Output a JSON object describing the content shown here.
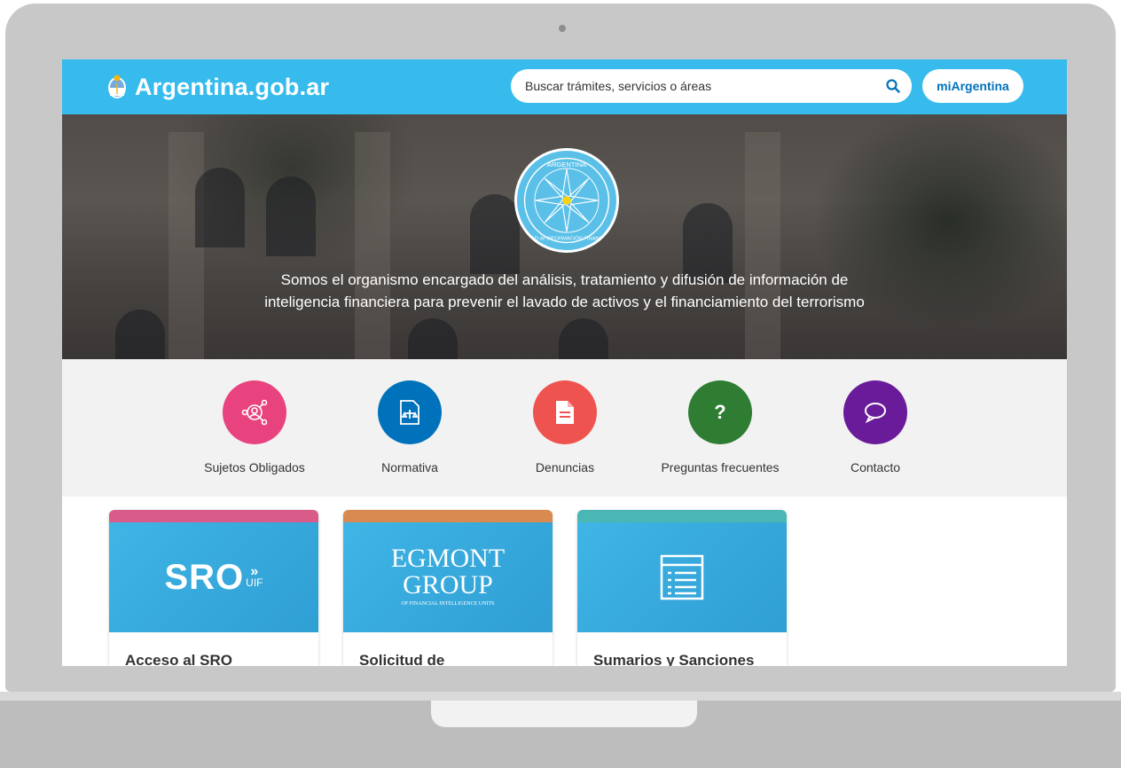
{
  "header": {
    "site_name": "Argentina.gob.ar",
    "search_placeholder": "Buscar trámites, servicios o áreas",
    "account_button": "miArgentina"
  },
  "hero": {
    "seal_text_top": "ARGENTINA",
    "seal_text_bottom": "UNIDAD de INFORMACIÓN FINANCIERA",
    "description_line1": "Somos el organismo encargado del análisis, tratamiento y difusión de información de",
    "description_line2": "inteligencia financiera para prevenir el lavado de activos y el financiamiento del terrorismo"
  },
  "quick_links": [
    {
      "label": "Sujetos Obligados",
      "color": "#e8437e",
      "icon": "people-network-icon"
    },
    {
      "label": "Normativa",
      "color": "#0072bb",
      "icon": "law-document-icon"
    },
    {
      "label": "Denuncias",
      "color": "#ef5350",
      "icon": "document-icon"
    },
    {
      "label": "Preguntas frecuentes",
      "color": "#2e7d32",
      "icon": "question-icon"
    },
    {
      "label": "Contacto",
      "color": "#6a1b9a",
      "icon": "chat-bubble-icon"
    }
  ],
  "cards": [
    {
      "title": "Acceso al SRO",
      "strip_color": "#d85b8a",
      "logo_main": "SRO",
      "logo_sub": "UIF"
    },
    {
      "title": "Solicitud de",
      "strip_color": "#d98a50",
      "logo_line1": "EGMONT",
      "logo_line2": "GROUP",
      "logo_small": "OF FINANCIAL INTELLIGENCE UNITS"
    },
    {
      "title": "Sumarios y Sanciones",
      "strip_color": "#4bb7b5",
      "icon": "list-document-icon"
    }
  ],
  "colors": {
    "topbar": "#37bbed",
    "quick_bg": "#f2f2f2",
    "frame": "#c8c8c8"
  }
}
